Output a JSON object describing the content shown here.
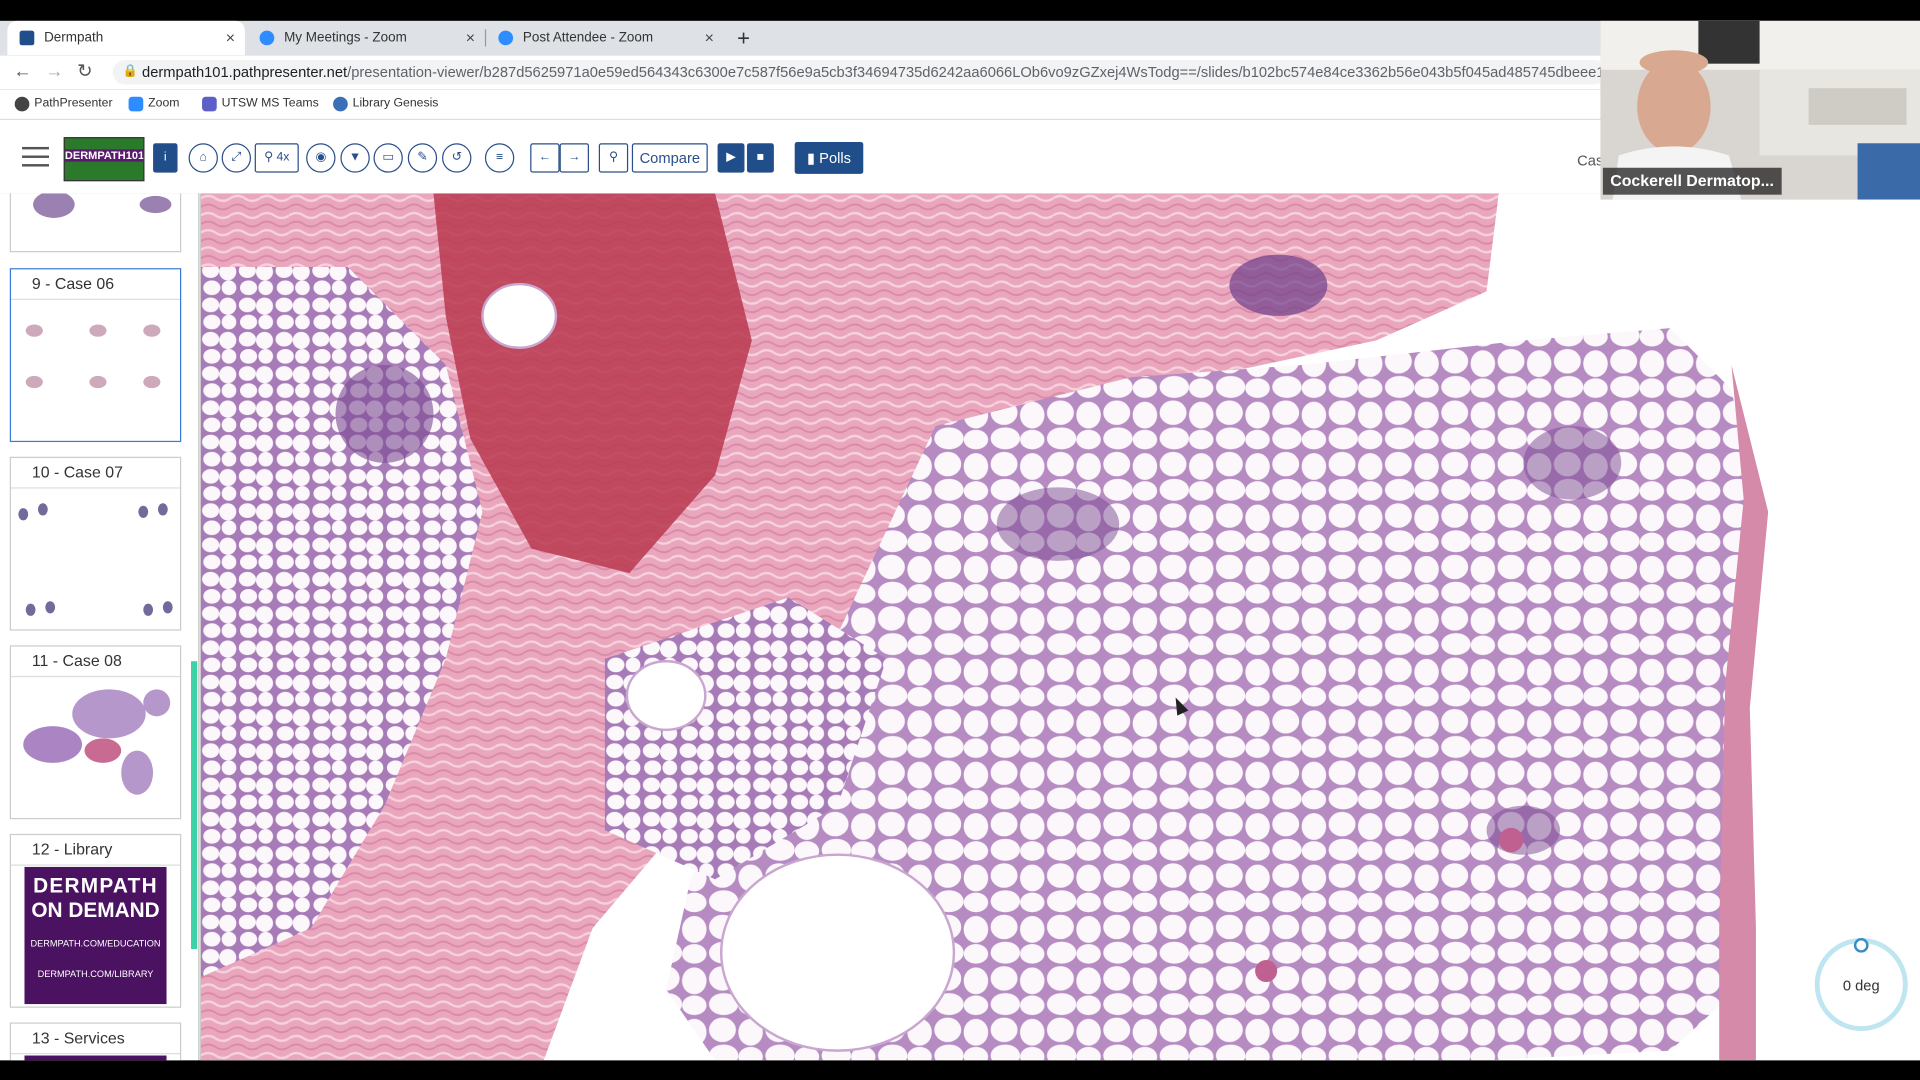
{
  "browser": {
    "tabs": [
      {
        "label": "Dermpath",
        "active": true,
        "color": "#1f4e8a"
      },
      {
        "label": "My Meetings - Zoom",
        "active": false,
        "color": "#2d8cff"
      },
      {
        "label": "Post Attendee - Zoom",
        "active": false,
        "color": "#2d8cff"
      }
    ],
    "close_glyph": "×",
    "newtab_glyph": "+",
    "url_host": "dermpath101.pathpresenter.net",
    "url_path": "/presentation-viewer/b287d5625971a0e59ed564343c6300e7c587f56e9a5cb3f34694735d6242aa6066LOb6vo9zGZxej4WsTodg==/slides/b102bc574e84ce3362b56e043b5f045ad485745dbeee16b8d34d4f...",
    "bookmarks": [
      "PathPresenter",
      "Zoom",
      "UTSW MS Teams",
      "Library Genesis"
    ]
  },
  "toolbar": {
    "logo_text": "DERMPATH101",
    "zoom_label": "4x",
    "compare_label": "Compare",
    "polls_label": "Polls",
    "case_partial": "Cas"
  },
  "sidebar": {
    "slides": [
      {
        "label": "9 - Case 06"
      },
      {
        "label": "10 - Case 07"
      },
      {
        "label": "11 - Case 08"
      },
      {
        "label": "12 - Library"
      },
      {
        "label": "13 - Services"
      }
    ],
    "library_thumb": {
      "line1": "DERMPATH",
      "line2": "ON DEMAND",
      "line3": "DERMPATH.COM/EDUCATION",
      "line4": "DERMPATH.COM/LIBRARY"
    }
  },
  "webcam": {
    "name": "Cockerell Dermatop..."
  },
  "rotation": {
    "label": "0 deg"
  }
}
